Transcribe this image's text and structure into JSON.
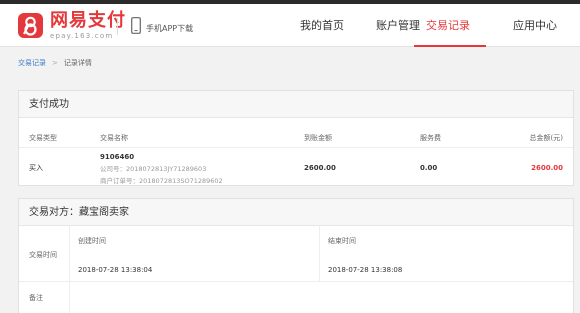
{
  "header": {
    "brand_name": "网易支付",
    "brand_domain": "epay.163.com",
    "app_download": "手机APP下载",
    "nav": [
      {
        "label": "我的首页",
        "active": false
      },
      {
        "label": "账户管理",
        "active": false
      },
      {
        "label": "交易记录",
        "active": true
      },
      {
        "label": "应用中心",
        "active": false
      }
    ]
  },
  "breadcrumb": {
    "parent": "交易记录",
    "separator": ">",
    "current": "记录详情"
  },
  "payment": {
    "title": "支付成功",
    "columns": {
      "type": "交易类型",
      "name": "交易名称",
      "received": "到账金额",
      "fee": "服务费",
      "total": "总金额(元)"
    },
    "row": {
      "type": "买入",
      "name": "9106460",
      "order_no": "公司号：2018072813JY71289603",
      "merchant_order_no": "商户订单号：2018072813SO71289602",
      "received": "2600.00",
      "fee": "0.00",
      "total": "2600.00"
    }
  },
  "counterparty": {
    "title": "交易对方：藏宝阁卖家",
    "time_label": "交易时间",
    "created_label": "创建时间",
    "created_value": "2018-07-28 13:38:04",
    "ended_label": "结束时间",
    "ended_value": "2018-07-28 13:38:08",
    "note_label": "备注"
  },
  "colors": {
    "accent": "#e4393c",
    "link": "#3a7cc7"
  }
}
